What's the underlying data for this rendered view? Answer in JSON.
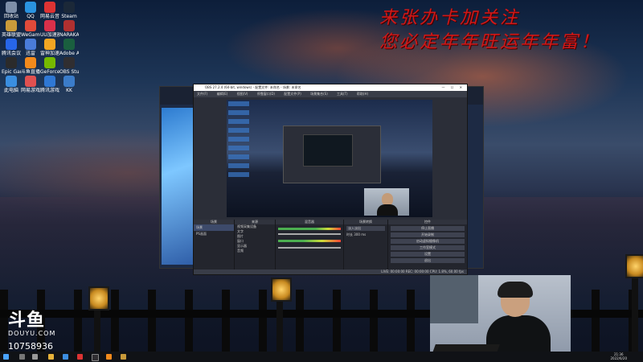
{
  "desktop": {
    "icons": [
      {
        "name": "icon-1",
        "label": "回收站",
        "color": "#7d8ea8"
      },
      {
        "name": "icon-2",
        "label": "QQ",
        "color": "#2a93e0"
      },
      {
        "name": "icon-3",
        "label": "网易云音乐",
        "color": "#d33"
      },
      {
        "name": "icon-4",
        "label": "Steam",
        "color": "#1b2838"
      },
      {
        "name": "icon-5",
        "label": "英雄联盟",
        "color": "#c99a3a"
      },
      {
        "name": "icon-6",
        "label": "WeGame",
        "color": "#e04a3a"
      },
      {
        "name": "icon-7",
        "label": "UU加速器",
        "color": "#d9304a"
      },
      {
        "name": "icon-8",
        "label": "NARAKA",
        "color": "#b03030"
      },
      {
        "name": "icon-9",
        "label": "腾讯会议",
        "color": "#2766e8"
      },
      {
        "name": "icon-10",
        "label": "迅雷",
        "color": "#4a7cd9"
      },
      {
        "name": "icon-11",
        "label": "雷神加速器",
        "color": "#f2a623"
      },
      {
        "name": "icon-12",
        "label": "Adobe Audition",
        "color": "#1a5f3f"
      },
      {
        "name": "icon-13",
        "label": "Epic Games",
        "color": "#2b2b2b"
      },
      {
        "name": "icon-14",
        "label": "斗鱼直播伴侣",
        "color": "#f38a1c"
      },
      {
        "name": "icon-15",
        "label": "GeForce Experience",
        "color": "#76b900"
      },
      {
        "name": "icon-16",
        "label": "OBS Studio",
        "color": "#302e31"
      },
      {
        "name": "icon-17",
        "label": "此电脑",
        "color": "#3a8ee0"
      },
      {
        "name": "icon-18",
        "label": "网易游戏",
        "color": "#e05050"
      },
      {
        "name": "icon-19",
        "label": "腾讯游戏",
        "color": "#2f78d4"
      },
      {
        "name": "icon-20",
        "label": "KK",
        "color": "#3b7cc9"
      }
    ]
  },
  "wallpaper_text": {
    "line1": "来张办卡加关注",
    "line2": "您必定年年旺运年年富！"
  },
  "watermark": {
    "logo_cn": "斗鱼",
    "logo_en": "DOUYU.COM",
    "room_id": "10758936"
  },
  "obs": {
    "title": "OBS 27.2.4 (64-bit, windows) - 配置文件: 未命名 - 场景: 未命名",
    "menu": [
      "文件(F)",
      "编辑(E)",
      "视图(V)",
      "停靠窗口(D)",
      "配置文件(P)",
      "场景集合(S)",
      "工具(T)",
      "帮助(H)"
    ],
    "panel_titles": {
      "scenes": "场景",
      "sources": "来源",
      "mixer": "混音器",
      "transitions": "场景转换",
      "controls": "控件"
    },
    "scene_items": [
      "场景",
      "PS画面"
    ],
    "source_items": [
      "视频采集设备",
      "文字",
      "图片",
      "窗口",
      "显示器",
      "音频"
    ],
    "transition_label": "淡入淡出",
    "duration_label": "时长",
    "duration_value": "300 ms",
    "controls": [
      "停止直播",
      "开始录制",
      "启动虚拟摄像机",
      "工作室模式",
      "设置",
      "退出"
    ],
    "status": "LIVE: 00:00:00   REC: 00:00:00   CPU: 1.8%, 60.00 fps"
  },
  "taskbar": {
    "time": "21:36",
    "date": "2022/6/20"
  }
}
